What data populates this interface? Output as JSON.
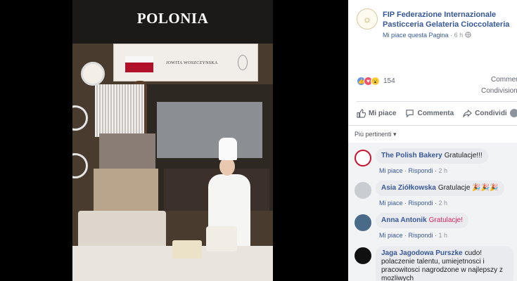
{
  "photo": {
    "title": "POLONIA",
    "sign_name": "JOWITA WOSZCZYNSKA"
  },
  "post": {
    "page_name": "FIP Federazione Internazionale Pasticceria Gelateria Cioccolateria",
    "like_page_label": "Mi piace questa Pagina",
    "separator": "·",
    "time": "6 h",
    "reaction_count": "154",
    "comments_label": "Commenti",
    "shares_label": "Condivisioni",
    "actions": {
      "like": "Mi piace",
      "comment": "Commenta",
      "share": "Condividi"
    },
    "sort_label": "Più pertinenti ▾"
  },
  "comments": [
    {
      "author": "The Polish Bakery",
      "text": "Gratulacje!!!",
      "like": "Mi piace",
      "reply": "Rispondi",
      "time": "2 h",
      "avatar_color": "#c8102e"
    },
    {
      "author": "Asia Ziółkowska",
      "text": "Gratulacje 🎉🎉🎉",
      "like": "Mi piace",
      "reply": "Rispondi",
      "time": "2 h",
      "avatar_color": "#c9ccd1"
    },
    {
      "author": "Anna Antonik",
      "text": "Gratulacje!",
      "like": "Mi piace",
      "reply": "Rispondi",
      "time": "1 h",
      "avatar_color": "#4a6a8a"
    },
    {
      "author": "Jaga Jagodowa Purszke",
      "text": "cudo! polaczenie talentu, umiejetnosci i pracowitosci nagrodzone w najlepszy z mozliwych",
      "avatar_color": "#101010"
    }
  ]
}
